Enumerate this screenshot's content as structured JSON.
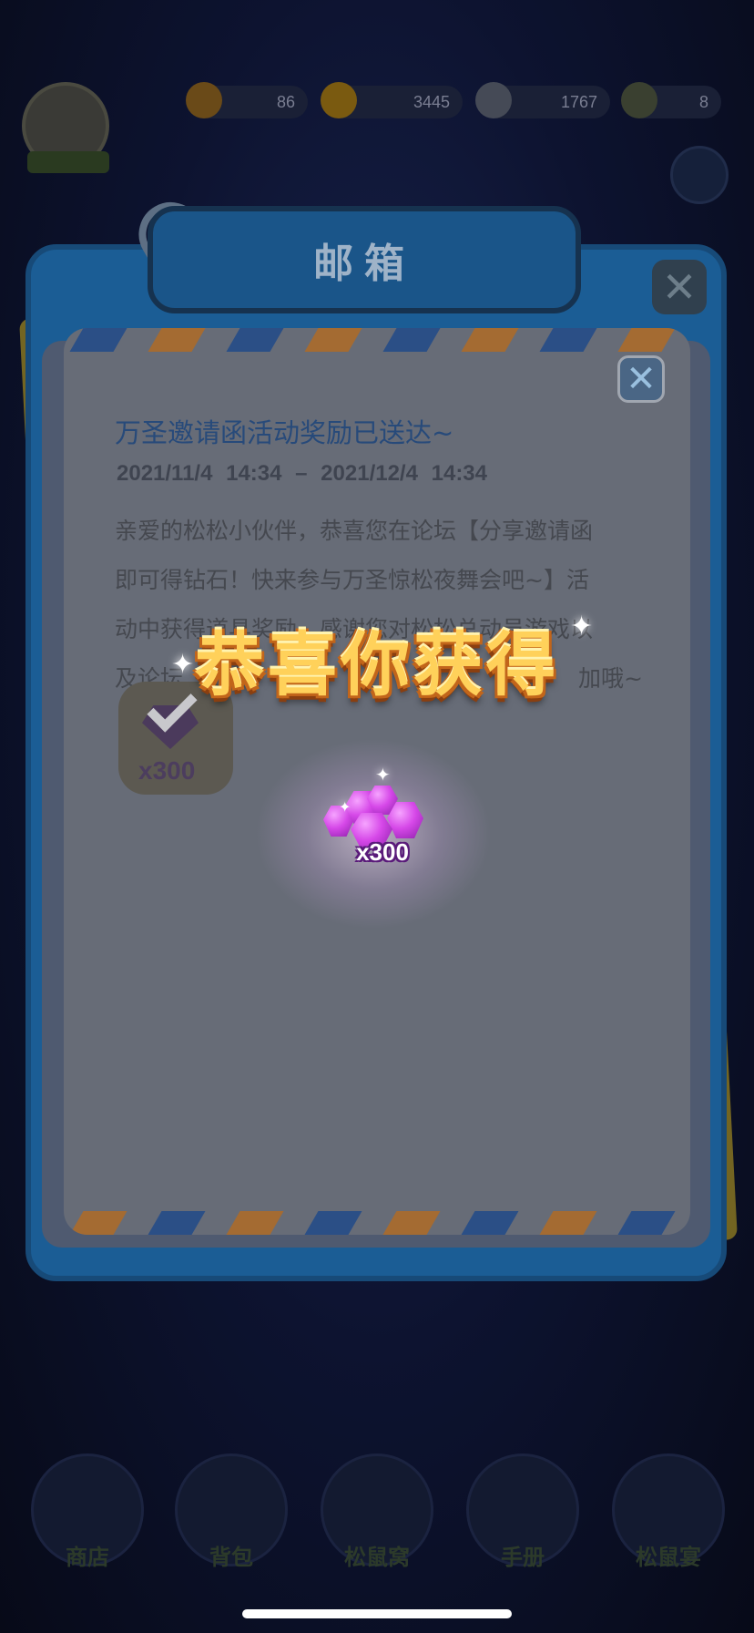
{
  "mailbox": {
    "title": "邮箱"
  },
  "mail": {
    "title": "万圣邀请函活动奖励已送达~",
    "date_range": "2021/11/4  14:34 – 2021/12/4  14:34",
    "body_lines": [
      "亲爱的松松小伙伴，恭喜您在论坛【分享邀请函",
      "即可得钻石！快来参与万圣惊松夜舞会吧~】活",
      "动中获得道具奖励，感谢您对松松总动员游戏以",
      "及论坛",
      "加哦~"
    ],
    "attachment": {
      "icon": "purple-gem-icon",
      "count": "x300",
      "claimed": true
    }
  },
  "reward_popup": {
    "title": "恭喜你获得",
    "item_icon": "purple-gems-icon",
    "count": "x300"
  },
  "resources": [
    {
      "icon": "acorn-icon",
      "value": "86"
    },
    {
      "icon": "coin-icon",
      "value": "3445"
    },
    {
      "icon": "diamond-icon",
      "value": "1767"
    },
    {
      "icon": "energy-icon",
      "value": "8"
    }
  ],
  "dock": [
    {
      "label": "商店"
    },
    {
      "label": "背包"
    },
    {
      "label": "松鼠窝"
    },
    {
      "label": "手册"
    },
    {
      "label": "松鼠宴"
    }
  ],
  "colors": {
    "envelope_stripe_orange": "#a46b32",
    "envelope_stripe_blue": "#2b4f86",
    "reward_title_gold": "#ffd15a",
    "gem_purple": "#d648e8"
  }
}
